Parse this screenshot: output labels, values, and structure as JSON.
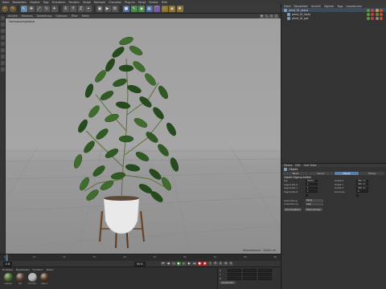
{
  "menubar": {
    "items": [
      "Datei",
      "Bearbeiten",
      "Objekte",
      "Tags",
      "Simulieren",
      "Rendern",
      "Skulpt",
      "MoGraph",
      "Charakter",
      "Plug-ins",
      "Skript",
      "Fenster",
      "Hilfe"
    ]
  },
  "viewport": {
    "menu": [
      "Ansicht",
      "Kameras",
      "Darstellung",
      "Optionen",
      "Filter",
      "Tafeln"
    ],
    "label": "Zentralperspektive",
    "footer": "Gitterabstand : 10000 cm"
  },
  "timeline": {
    "ticks": [
      "0",
      "10",
      "20",
      "30",
      "40",
      "50",
      "60",
      "70",
      "80",
      "90"
    ],
    "start_frame": "0 B",
    "end_frame": "90 B"
  },
  "materials": {
    "menu": [
      "Erstellen",
      "Bearbeiten",
      "Funktion",
      "Textur"
    ],
    "items": [
      {
        "name": "Leaves",
        "color": "#4d6e2a"
      },
      {
        "name": "Pot",
        "color": "#5e4030"
      },
      {
        "name": "Ceramic",
        "color": "#bbbbbb"
      },
      {
        "name": "Stand",
        "color": "#5a3a22"
      }
    ]
  },
  "coords": {
    "rows": [
      "X",
      "Y",
      "Z"
    ],
    "apply_label": "Anwenden"
  },
  "object_manager": {
    "menu": [
      "Datei",
      "Bearbeiten",
      "Ansicht",
      "Objekte",
      "Tags",
      "Lesezeichen"
    ],
    "rows": [
      {
        "name": "plant_01_stand"
      },
      {
        "name": "plant_01_body"
      },
      {
        "name": "plant_01_pot"
      }
    ]
  },
  "attributes": {
    "menu": [
      "Modus",
      "Edit",
      "User Data"
    ],
    "title": "Objekt",
    "tabs": [
      "Basis",
      "Koord.",
      "Objekt",
      "Phong"
    ],
    "section": "Objekt-Eigenschaften",
    "params": [
      {
        "label": "Typ",
        "value": "Würfel"
      },
      {
        "label": "Größe X",
        "value": "200 cm"
      },
      {
        "label": "Segmente X",
        "value": "1"
      },
      {
        "label": "Größe Y",
        "value": "200 cm"
      },
      {
        "label": "Segmente Y",
        "value": "1"
      },
      {
        "label": "Größe Z",
        "value": "200 cm"
      },
      {
        "label": "Segmente Z",
        "value": "1"
      },
      {
        "label": "Rundung",
        "value": "0"
      }
    ],
    "dropdowns": [
      {
        "label": "Ausrichtung",
        "value": "Keine"
      },
      {
        "label": "Unterteilung",
        "value": "Auto"
      }
    ],
    "buttons": [
      "Zurücksetzen",
      "Übernehmen"
    ]
  }
}
